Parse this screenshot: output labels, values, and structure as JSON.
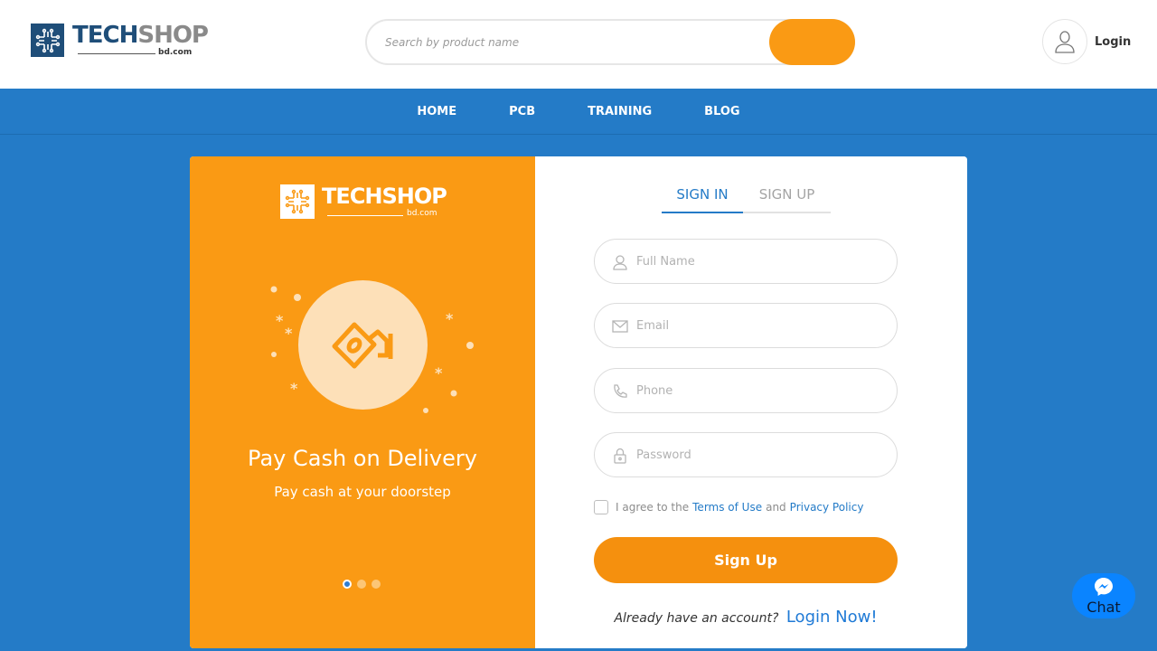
{
  "header": {
    "logo": {
      "brand_main": "TECH",
      "brand_accent": "SHOP",
      "domain": "bd.com"
    },
    "search": {
      "placeholder": "Search by product name"
    },
    "account": {
      "login_label": "Login"
    }
  },
  "nav": {
    "items": [
      {
        "label": "HOME"
      },
      {
        "label": "PCB"
      },
      {
        "label": "TRAINING"
      },
      {
        "label": "BLOG"
      }
    ]
  },
  "promo": {
    "logo": {
      "brand": "TECHSHOP",
      "domain": "bd.com"
    },
    "title": "Pay Cash on Delivery",
    "subtitle": "Pay cash at your doorstep",
    "slides": {
      "count": 3,
      "active": 1
    }
  },
  "form": {
    "tabs": [
      {
        "label": "SIGN IN",
        "active": true
      },
      {
        "label": "SIGN UP",
        "active": false
      }
    ],
    "fields": [
      {
        "placeholder": "Full Name",
        "icon": "user-icon",
        "value": ""
      },
      {
        "placeholder": "Email",
        "icon": "envelope-icon",
        "value": ""
      },
      {
        "placeholder": "Phone",
        "icon": "phone-icon",
        "value": ""
      },
      {
        "placeholder": "Password",
        "icon": "lock-icon",
        "value": ""
      }
    ],
    "agree": {
      "prefix": "I agree to the",
      "terms": "Terms of Use",
      "and": "and",
      "privacy": "Privacy Policy",
      "checked": false
    },
    "submit_label": "Sign Up",
    "already_text": "Already have an account?",
    "login_now": "Login Now!"
  },
  "chat": {
    "label": "Chat",
    "icon": "messenger-icon"
  },
  "colors": {
    "brand_blue": "#247bc7",
    "accent_orange": "#fa9a14",
    "button_orange": "#f5900e",
    "link_blue": "#1f7ad6"
  }
}
